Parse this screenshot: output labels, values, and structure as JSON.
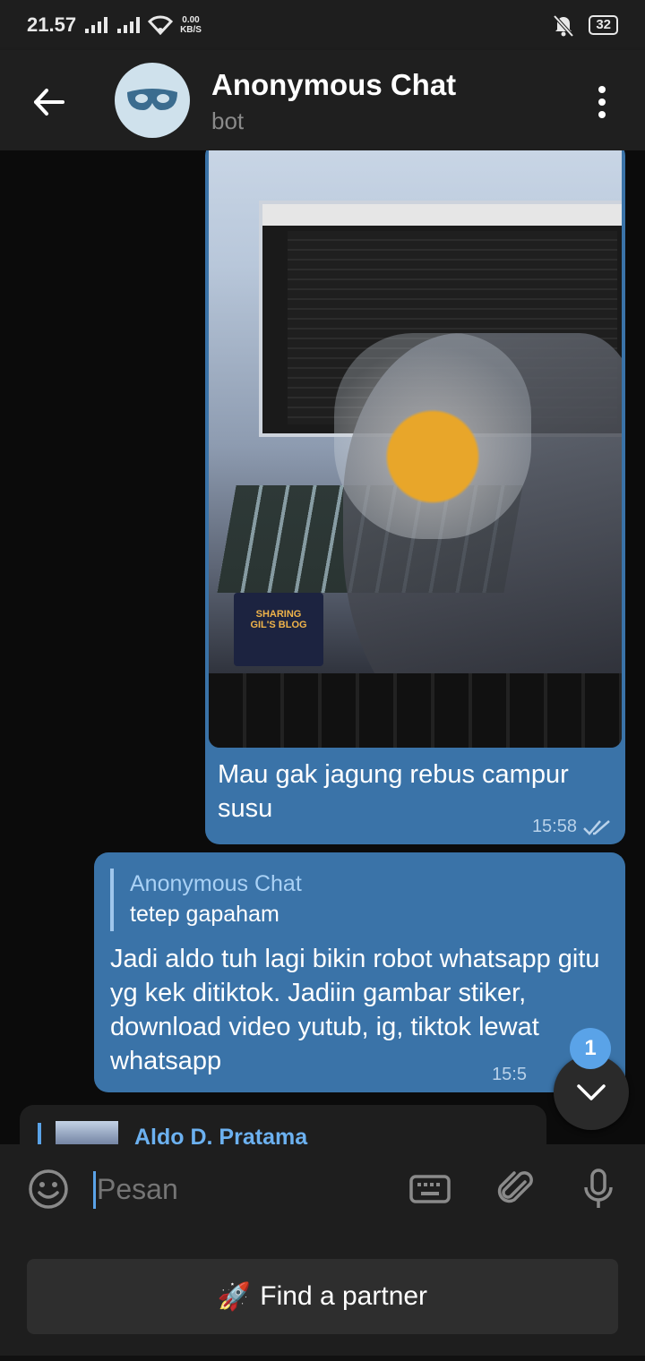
{
  "status_bar": {
    "time": "21.57",
    "net_speed_value": "0.00",
    "net_speed_unit": "KB/S",
    "battery": "32",
    "icons": [
      "signal-icon",
      "signal-icon",
      "wifi-icon",
      "mute-icon",
      "battery-icon"
    ]
  },
  "header": {
    "title": "Anonymous Chat",
    "subtitle": "bot",
    "avatar_icon": "mask-icon",
    "back_icon": "arrow-left-icon",
    "menu_icon": "more-vertical-icon"
  },
  "messages": [
    {
      "type": "photo",
      "direction": "outgoing",
      "caption": "Mau gak jagung rebus campur susu",
      "time": "15:58",
      "status_icon": "double-check-icon",
      "photo_sticker_text": "SHARING\nGIL'S BLOG"
    },
    {
      "type": "reply",
      "direction": "outgoing",
      "quote_name": "Anonymous Chat",
      "quote_text": "tetep gapaham",
      "text": "Jadi aldo tuh lagi bikin robot whatsapp gitu yg kek ditiktok. Jadiin gambar stiker, download video yutub, ig, tiktok lewat whatsapp",
      "time": "15:5"
    },
    {
      "type": "reply-partial",
      "direction": "incoming",
      "quote_name": "Aldo D. Pratama"
    }
  ],
  "scroll_fab": {
    "badge": "1",
    "icon": "chevron-down-icon"
  },
  "input": {
    "placeholder": "Pesan",
    "value": "",
    "icons": [
      "emoji-icon",
      "keyboard-icon",
      "attach-icon",
      "mic-icon"
    ]
  },
  "bot_keyboard": {
    "button_label": "Find a partner",
    "button_emoji": "🚀"
  },
  "colors": {
    "accent": "#5aa3e8",
    "outgoing_bubble": "#3a73a8",
    "background": "#0b0b0b"
  }
}
